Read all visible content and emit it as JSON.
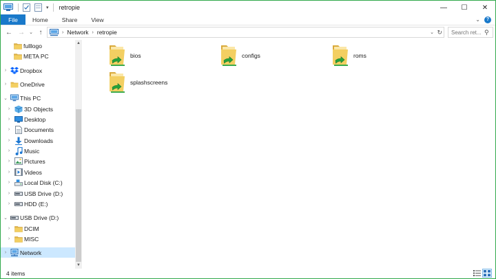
{
  "window": {
    "title": "retropie",
    "controls": {
      "minimize": "—",
      "maximize": "☐",
      "close": "✕"
    }
  },
  "ribbon": {
    "file": "File",
    "tabs": [
      "Home",
      "Share",
      "View"
    ],
    "expand": "⌄",
    "help": "?"
  },
  "nav": {
    "back": "←",
    "forward": "→",
    "recent": "⌄",
    "up": "↑",
    "breadcrumb": [
      "Network",
      "retropie"
    ],
    "crumb_sep": "›",
    "dropdown": "⌄",
    "refresh": "↻",
    "search_placeholder": "Search ret...",
    "search_icon": "⚲"
  },
  "tree": [
    {
      "label": "fulllogo",
      "icon": "folder-icon",
      "expand": ""
    },
    {
      "label": "META PC",
      "icon": "folder-icon",
      "expand": ""
    },
    {
      "label": "Dropbox",
      "icon": "dropbox-icon",
      "expand": "›"
    },
    {
      "label": "OneDrive",
      "icon": "onedrive-icon",
      "expand": "›"
    },
    {
      "label": "This PC",
      "icon": "computer-icon",
      "expand": "⌄"
    },
    {
      "label": "3D Objects",
      "icon": "cube-icon",
      "expand": "›"
    },
    {
      "label": "Desktop",
      "icon": "desktop-icon",
      "expand": "›"
    },
    {
      "label": "Documents",
      "icon": "document-icon",
      "expand": "›"
    },
    {
      "label": "Downloads",
      "icon": "download-icon",
      "expand": "›"
    },
    {
      "label": "Music",
      "icon": "music-icon",
      "expand": "›"
    },
    {
      "label": "Pictures",
      "icon": "picture-icon",
      "expand": "›"
    },
    {
      "label": "Videos",
      "icon": "video-icon",
      "expand": "›"
    },
    {
      "label": "Local Disk (C:)",
      "icon": "local-disk-icon",
      "expand": "›"
    },
    {
      "label": "USB Drive (D:)",
      "icon": "usb-drive-icon",
      "expand": "›"
    },
    {
      "label": "HDD (E:)",
      "icon": "hdd-icon",
      "expand": "›"
    },
    {
      "label": "USB Drive (D:)",
      "icon": "usb-drive-icon",
      "expand": "⌄"
    },
    {
      "label": "DCIM",
      "icon": "folder-icon",
      "expand": "›"
    },
    {
      "label": "MISC",
      "icon": "folder-icon",
      "expand": "›"
    },
    {
      "label": "Network",
      "icon": "network-icon",
      "expand": "›",
      "selected": true
    }
  ],
  "scroll": {
    "up": "▲",
    "down": "▼"
  },
  "files": [
    {
      "name": "bios",
      "icon": "shared-folder-icon"
    },
    {
      "name": "configs",
      "icon": "shared-folder-icon"
    },
    {
      "name": "roms",
      "icon": "shared-folder-icon"
    },
    {
      "name": "splashscreens",
      "icon": "shared-folder-icon"
    }
  ],
  "status": {
    "items": "4 items"
  },
  "colors": {
    "accent": "#1979ca",
    "folder": "#f3cf62",
    "share_arrow": "#27a23a",
    "selection": "#cce8ff",
    "window_border": "#2fa84a"
  }
}
